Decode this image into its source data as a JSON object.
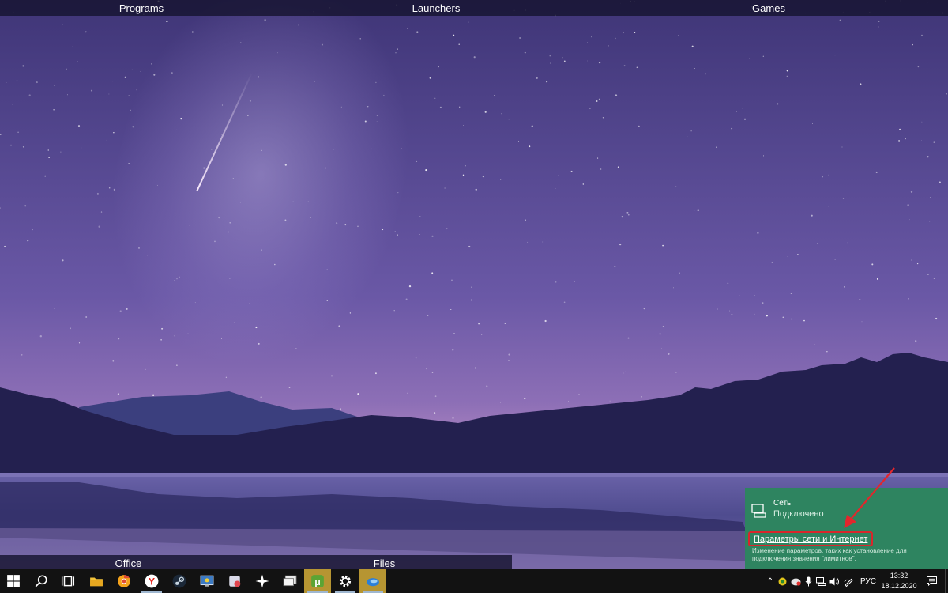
{
  "desktop": {
    "fences": {
      "programs": "Programs",
      "launchers": "Launchers",
      "games": "Games",
      "office": "Office",
      "files": "Files"
    }
  },
  "network_flyout": {
    "network_name": "Сеть",
    "status": "Подключено",
    "settings_link": "Параметры сети и Интернет",
    "settings_description": "Изменение параметров, таких как установление для подключения значения \"лимитное\"."
  },
  "taskbar": {
    "pinned_icons": [
      "start-icon",
      "search-icon",
      "task-view-icon",
      "file-explorer-icon",
      "chrome-icon",
      "yandex-browser-icon",
      "steam-icon",
      "network-monitor-icon",
      "app-icon",
      "sparkle-app-icon",
      "remote-desktop-icon",
      "utorrent-icon",
      "settings-icon",
      "edge-icon"
    ],
    "tray": {
      "language": "РУС",
      "time": "13:32",
      "date": "18.12.2020"
    }
  },
  "colors": {
    "flyout_bg": "#2e8460",
    "highlight_border": "#d9262b",
    "taskbar_bg": "#121212",
    "active_taskbar_item": "#b69532"
  }
}
